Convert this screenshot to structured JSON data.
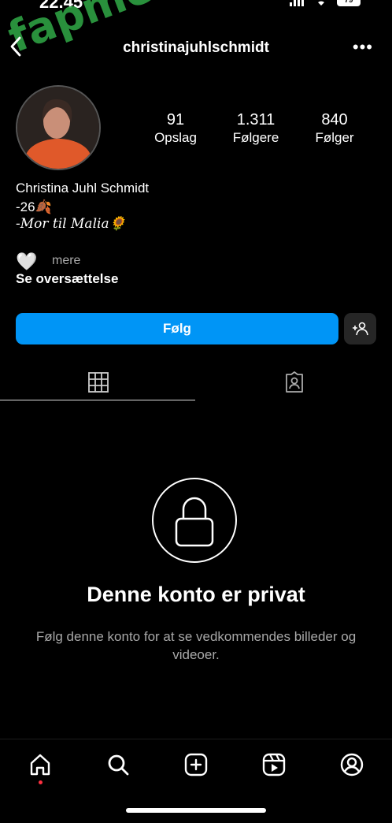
{
  "status_bar": {
    "time": "22.45",
    "battery": "79"
  },
  "watermark": "fapmenu.com",
  "header": {
    "username": "christinajuhlschmidt"
  },
  "stats": [
    {
      "count": "91",
      "label": "Opslag"
    },
    {
      "count": "1.311",
      "label": "Følgere"
    },
    {
      "count": "840",
      "label": "Følger"
    }
  ],
  "profile": {
    "name": "Christina Juhl Schmidt",
    "bio_line1": "-26🍂",
    "bio_line2": "-Mor til Malia🌻",
    "heart": "🤍",
    "more": "mere",
    "translate": "Se oversættelse"
  },
  "actions": {
    "follow": "Følg"
  },
  "private": {
    "title": "Denne konto er privat",
    "description": "Følg denne konto for at se vedkommendes billeder og videoer."
  },
  "colors": {
    "accent": "#0095f6",
    "background": "#000000",
    "secondary_button": "#262626"
  },
  "icons": {
    "tabs": [
      "grid-icon",
      "tagged-icon"
    ],
    "nav": [
      "home-icon",
      "search-icon",
      "create-icon",
      "reels-icon",
      "profile-icon"
    ]
  }
}
